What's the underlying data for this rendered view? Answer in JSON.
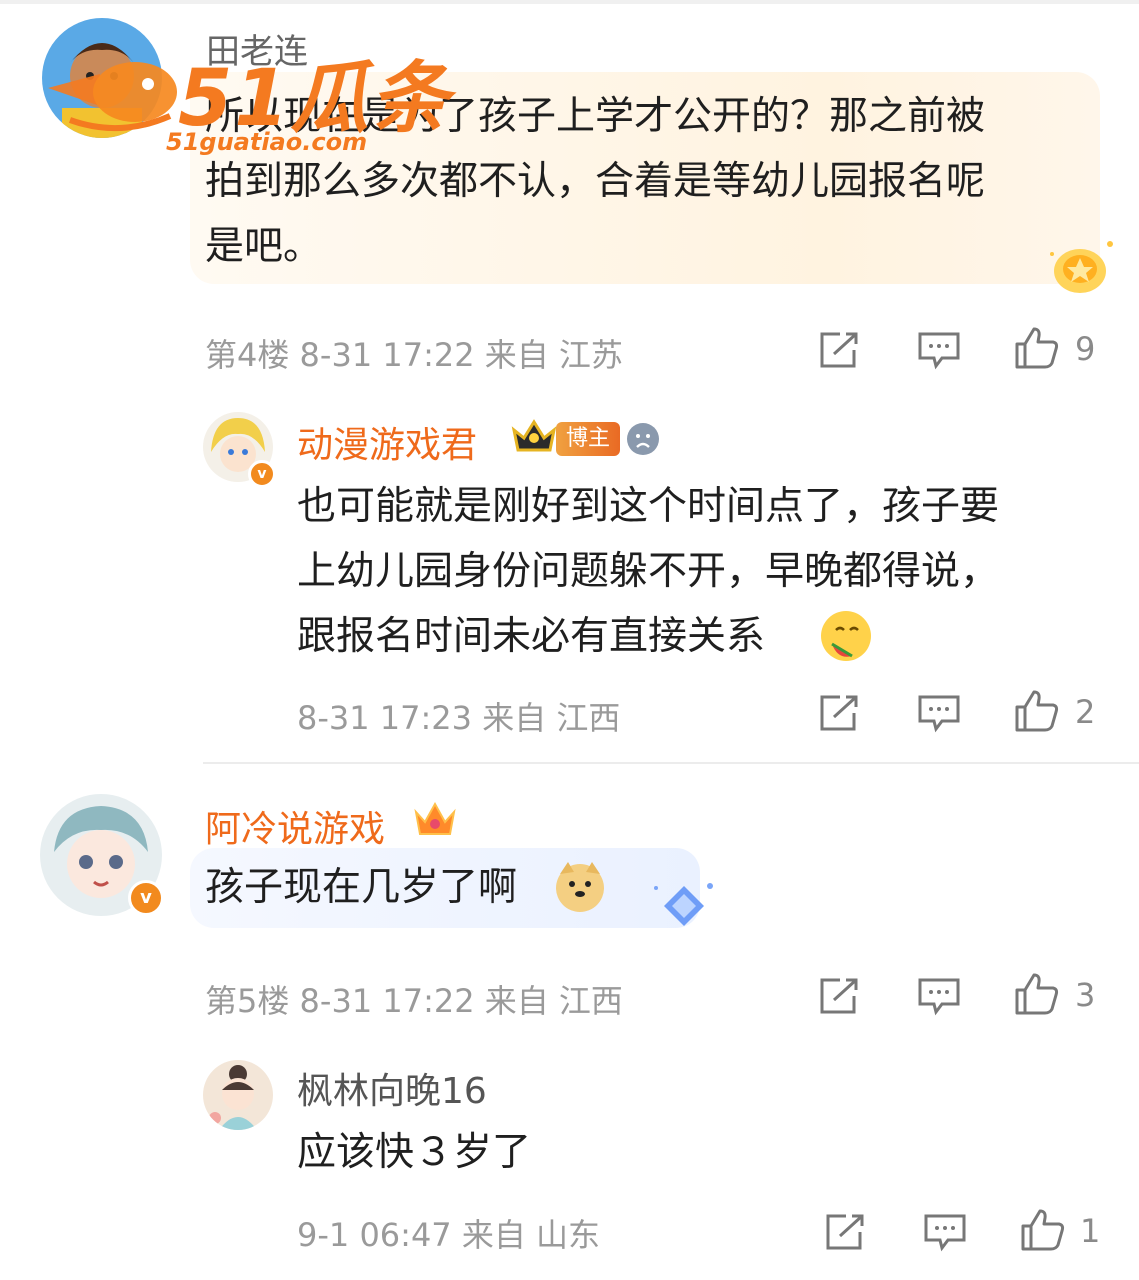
{
  "watermark": {
    "brand": "51瓜条",
    "url": "51guatiao.com"
  },
  "comments": [
    {
      "username": "田老连",
      "text_lines": [
        "所以现在是为了孩子上学才公开的？那之前被",
        "拍到那么多次都不认，合着是等幼儿园报名呢",
        "是吧。"
      ],
      "floor": "第4楼",
      "time": "8-31 17:22",
      "from": "来自",
      "location": "江苏",
      "likes": "9"
    },
    {
      "username": "动漫游戏君",
      "badge": "博主",
      "text_lines": [
        "也可能就是刚好到这个时间点了，孩子要",
        "上幼儿园身份问题躲不开，早晚都得说，",
        "跟报名时间未必有直接关系"
      ],
      "time": "8-31 17:23",
      "from": "来自",
      "location": "江西",
      "likes": "2"
    },
    {
      "username": "阿冷说游戏",
      "text_lines": [
        "孩子现在几岁了啊"
      ],
      "floor": "第5楼",
      "time": "8-31 17:22",
      "from": "来自",
      "location": "江西",
      "likes": "3"
    },
    {
      "username": "枫林向晚16",
      "text_lines": [
        "应该快３岁了"
      ],
      "time": "9-1 06:47",
      "from": "来自",
      "location": "山东",
      "likes": "1"
    }
  ],
  "colors": {
    "accent_orange": "#ef6a1b",
    "meta_gray": "#9a9a9a"
  }
}
